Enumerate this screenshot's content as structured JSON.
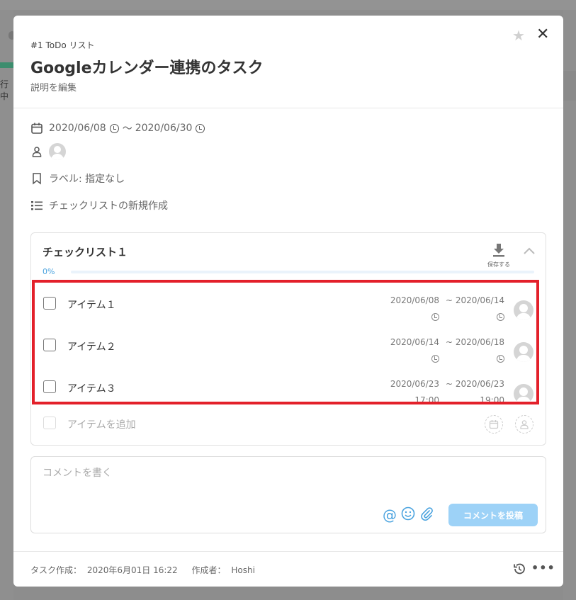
{
  "background": {
    "tab_text": "行中"
  },
  "modal": {
    "breadcrumb": "#1 ToDo リスト",
    "title": "Googleカレンダー連携のタスク",
    "edit_description": "説明を編集",
    "star_icon": "★",
    "close_icon": "✕"
  },
  "meta": {
    "start_date": "2020/06/08",
    "range_sep": "～",
    "end_date": "2020/06/30",
    "label_text": "ラベル: 指定なし",
    "new_checklist": "チェックリストの新規作成"
  },
  "checklist": {
    "title": "チェックリスト１",
    "save_label": "保存する",
    "progress_text": "0%",
    "progress": 0,
    "items": [
      {
        "name": "アイテム１",
        "start": "2020/06/08",
        "sep": "~",
        "end": "2020/06/14",
        "start_time": "",
        "end_time": "",
        "checked": false
      },
      {
        "name": "アイテム２",
        "start": "2020/06/14",
        "sep": "~",
        "end": "2020/06/18",
        "start_time": "",
        "end_time": "",
        "checked": false
      },
      {
        "name": "アイテム３",
        "start": "2020/06/23",
        "sep": "~",
        "end": "2020/06/23",
        "start_time": "17:00",
        "end_time": "19:00",
        "checked": false
      }
    ],
    "add_item_placeholder": "アイテムを追加"
  },
  "comment": {
    "placeholder": "コメントを書く",
    "at_icon": "@",
    "post_label": "コメントを投稿"
  },
  "footer": {
    "created_label": "タスク作成：",
    "created_value": "2020年6月01日 16:22",
    "author_label": "作成者：",
    "author_value": "Hoshi",
    "more_icon": "•••"
  },
  "colors": {
    "accent": "#4aa3df",
    "highlight": "#e3202a",
    "post_button": "#9dd2f7"
  }
}
